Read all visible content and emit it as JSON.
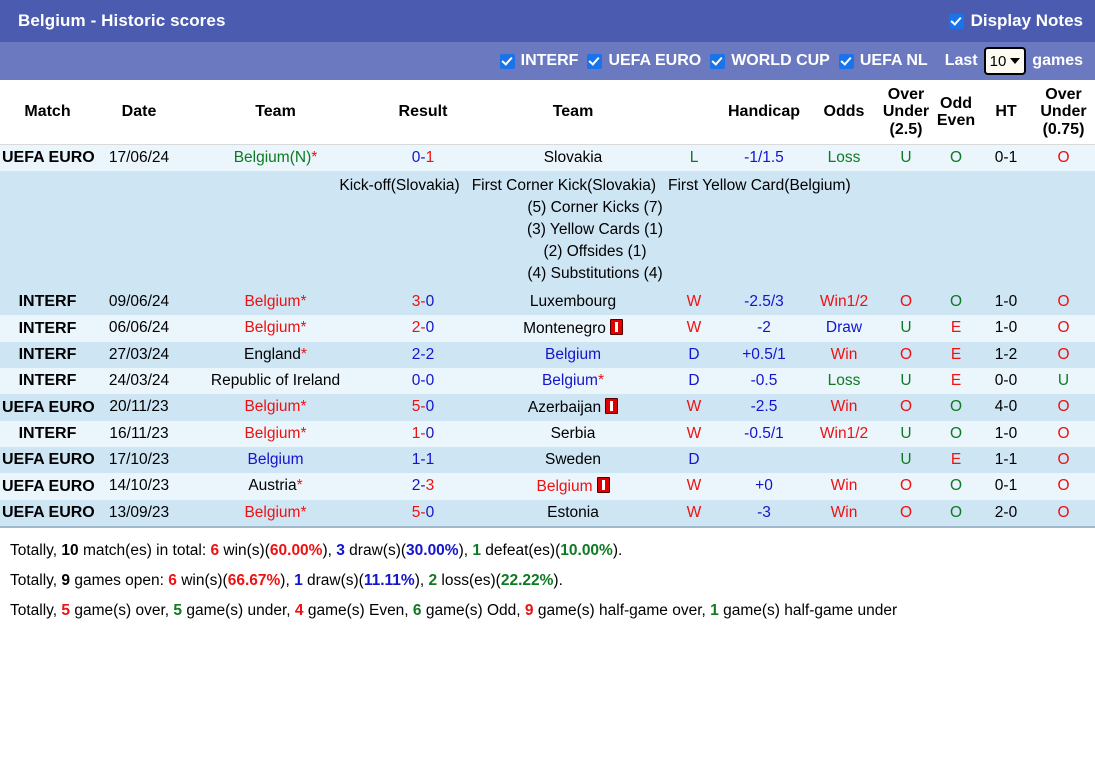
{
  "header": {
    "title": "Belgium - Historic scores",
    "display_notes_label": "Display Notes",
    "display_notes_checked": true,
    "accent_bar": "#4a5bb0",
    "filter_bar": "#6a79c0"
  },
  "filters": {
    "items": [
      {
        "label": "INTERF",
        "checked": true
      },
      {
        "label": "UEFA EURO",
        "checked": true
      },
      {
        "label": "WORLD CUP",
        "checked": true
      },
      {
        "label": "UEFA NL",
        "checked": true
      }
    ],
    "last_label": "Last",
    "games_value": "10",
    "games_label": "games"
  },
  "columns": [
    {
      "key": "match",
      "label": "Match"
    },
    {
      "key": "date",
      "label": "Date"
    },
    {
      "key": "home",
      "label": "Team"
    },
    {
      "key": "result",
      "label": "Result"
    },
    {
      "key": "away",
      "label": "Team"
    },
    {
      "key": "wdl",
      "label": ""
    },
    {
      "key": "handicap",
      "label": "Handicap"
    },
    {
      "key": "odds",
      "label": "Odds"
    },
    {
      "key": "ou25",
      "label": "Over Under (2.5)"
    },
    {
      "key": "oddeven",
      "label": "Odd Even"
    },
    {
      "key": "ht",
      "label": "HT"
    },
    {
      "key": "ou075",
      "label": "Over Under (0.75)"
    }
  ],
  "column_labels": {
    "ou25_l1": "Over",
    "ou25_l2": "Under",
    "ou25_l3": "(2.5)",
    "oddeven_l1": "Odd",
    "oddeven_l2": "Even",
    "ou075_l1": "Over",
    "ou075_l2": "Under",
    "ou075_l3": "(0.75)"
  },
  "rows": [
    {
      "comp": "UEFA EURO",
      "comp_type": "euro",
      "date": "17/06/24",
      "home": "Belgium(N)",
      "home_color": "green",
      "home_star": true,
      "home_card": false,
      "result": "0-1",
      "result_left_color": "blue",
      "result_right_color": "red",
      "away": "Slovakia",
      "away_color": "black",
      "away_star": false,
      "away_card": false,
      "wdl": "L",
      "wdl_color": "green",
      "handicap": "-1/1.5",
      "handicap_color": "blue",
      "odds": "Loss",
      "odds_color": "green",
      "ou25": "U",
      "ou25_color": "green",
      "oddeven": "O",
      "oddeven_color": "green",
      "ht": "0-1",
      "ht_color": "black",
      "ou075": "O",
      "ou075_color": "red",
      "notes": {
        "line1": [
          "Kick-off(Slovakia)",
          "First Corner Kick(Slovakia)",
          "First Yellow Card(Belgium)"
        ],
        "lines": [
          "(5) Corner Kicks (7)",
          "(3) Yellow Cards (1)",
          "(2) Offsides (1)",
          "(4) Substitutions (4)"
        ]
      }
    },
    {
      "comp": "INTERF",
      "comp_type": "interf",
      "date": "09/06/24",
      "home": "Belgium",
      "home_color": "red",
      "home_star": true,
      "home_card": false,
      "result": "3-0",
      "result_left_color": "red",
      "result_right_color": "blue",
      "away": "Luxembourg",
      "away_color": "black",
      "away_star": false,
      "away_card": false,
      "wdl": "W",
      "wdl_color": "red",
      "handicap": "-2.5/3",
      "handicap_color": "blue",
      "odds": "Win1/2",
      "odds_color": "red",
      "ou25": "O",
      "ou25_color": "red",
      "oddeven": "O",
      "oddeven_color": "green",
      "ht": "1-0",
      "ht_color": "black",
      "ou075": "O",
      "ou075_color": "red",
      "notes": null
    },
    {
      "comp": "INTERF",
      "comp_type": "interf",
      "date": "06/06/24",
      "home": "Belgium",
      "home_color": "red",
      "home_star": true,
      "home_card": false,
      "result": "2-0",
      "result_left_color": "red",
      "result_right_color": "blue",
      "away": "Montenegro",
      "away_color": "black",
      "away_star": false,
      "away_card": true,
      "wdl": "W",
      "wdl_color": "red",
      "handicap": "-2",
      "handicap_color": "blue",
      "odds": "Draw",
      "odds_color": "blue",
      "ou25": "U",
      "ou25_color": "green",
      "oddeven": "E",
      "oddeven_color": "red",
      "ht": "1-0",
      "ht_color": "black",
      "ou075": "O",
      "ou075_color": "red",
      "notes": null
    },
    {
      "comp": "INTERF",
      "comp_type": "interf",
      "date": "27/03/24",
      "home": "England",
      "home_color": "black",
      "home_star": true,
      "home_card": false,
      "result": "2-2",
      "result_left_color": "blue",
      "result_right_color": "blue",
      "away": "Belgium",
      "away_color": "blue",
      "away_star": false,
      "away_card": false,
      "wdl": "D",
      "wdl_color": "blue",
      "handicap": "+0.5/1",
      "handicap_color": "blue",
      "odds": "Win",
      "odds_color": "red",
      "ou25": "O",
      "ou25_color": "red",
      "oddeven": "E",
      "oddeven_color": "red",
      "ht": "1-2",
      "ht_color": "black",
      "ou075": "O",
      "ou075_color": "red",
      "notes": null
    },
    {
      "comp": "INTERF",
      "comp_type": "interf",
      "date": "24/03/24",
      "home": "Republic of Ireland",
      "home_color": "black",
      "home_star": false,
      "home_card": false,
      "result": "0-0",
      "result_left_color": "blue",
      "result_right_color": "blue",
      "away": "Belgium",
      "away_color": "blue",
      "away_star": true,
      "away_card": false,
      "wdl": "D",
      "wdl_color": "blue",
      "handicap": "-0.5",
      "handicap_color": "blue",
      "odds": "Loss",
      "odds_color": "green",
      "ou25": "U",
      "ou25_color": "green",
      "oddeven": "E",
      "oddeven_color": "red",
      "ht": "0-0",
      "ht_color": "black",
      "ou075": "U",
      "ou075_color": "green",
      "notes": null
    },
    {
      "comp": "UEFA EURO",
      "comp_type": "euro",
      "date": "20/11/23",
      "home": "Belgium",
      "home_color": "red",
      "home_star": true,
      "home_card": false,
      "result": "5-0",
      "result_left_color": "red",
      "result_right_color": "blue",
      "away": "Azerbaijan",
      "away_color": "black",
      "away_star": false,
      "away_card": true,
      "wdl": "W",
      "wdl_color": "red",
      "handicap": "-2.5",
      "handicap_color": "blue",
      "odds": "Win",
      "odds_color": "red",
      "ou25": "O",
      "ou25_color": "red",
      "oddeven": "O",
      "oddeven_color": "green",
      "ht": "4-0",
      "ht_color": "black",
      "ou075": "O",
      "ou075_color": "red",
      "notes": null
    },
    {
      "comp": "INTERF",
      "comp_type": "interf",
      "date": "16/11/23",
      "home": "Belgium",
      "home_color": "red",
      "home_star": true,
      "home_card": false,
      "result": "1-0",
      "result_left_color": "red",
      "result_right_color": "blue",
      "away": "Serbia",
      "away_color": "black",
      "away_star": false,
      "away_card": false,
      "wdl": "W",
      "wdl_color": "red",
      "handicap": "-0.5/1",
      "handicap_color": "blue",
      "odds": "Win1/2",
      "odds_color": "red",
      "ou25": "U",
      "ou25_color": "green",
      "oddeven": "O",
      "oddeven_color": "green",
      "ht": "1-0",
      "ht_color": "black",
      "ou075": "O",
      "ou075_color": "red",
      "notes": null
    },
    {
      "comp": "UEFA EURO",
      "comp_type": "euro",
      "date": "17/10/23",
      "home": "Belgium",
      "home_color": "blue",
      "home_star": false,
      "home_card": false,
      "result": "1-1",
      "result_left_color": "blue",
      "result_right_color": "blue",
      "away": "Sweden",
      "away_color": "black",
      "away_star": false,
      "away_card": false,
      "wdl": "D",
      "wdl_color": "blue",
      "handicap": "",
      "handicap_color": "blue",
      "odds": "",
      "odds_color": "black",
      "ou25": "U",
      "ou25_color": "green",
      "oddeven": "E",
      "oddeven_color": "red",
      "ht": "1-1",
      "ht_color": "black",
      "ou075": "O",
      "ou075_color": "red",
      "notes": null
    },
    {
      "comp": "UEFA EURO",
      "comp_type": "euro",
      "date": "14/10/23",
      "home": "Austria",
      "home_color": "black",
      "home_star": true,
      "home_card": false,
      "result": "2-3",
      "result_left_color": "blue",
      "result_right_color": "red",
      "away": "Belgium",
      "away_color": "red",
      "away_star": false,
      "away_card": true,
      "wdl": "W",
      "wdl_color": "red",
      "handicap": "+0",
      "handicap_color": "blue",
      "odds": "Win",
      "odds_color": "red",
      "ou25": "O",
      "ou25_color": "red",
      "oddeven": "O",
      "oddeven_color": "green",
      "ht": "0-1",
      "ht_color": "black",
      "ou075": "O",
      "ou075_color": "red",
      "notes": null
    },
    {
      "comp": "UEFA EURO",
      "comp_type": "euro",
      "date": "13/09/23",
      "home": "Belgium",
      "home_color": "red",
      "home_star": true,
      "home_card": false,
      "result": "5-0",
      "result_left_color": "red",
      "result_right_color": "blue",
      "away": "Estonia",
      "away_color": "black",
      "away_star": false,
      "away_card": false,
      "wdl": "W",
      "wdl_color": "red",
      "handicap": "-3",
      "handicap_color": "blue",
      "odds": "Win",
      "odds_color": "red",
      "ou25": "O",
      "ou25_color": "red",
      "oddeven": "O",
      "oddeven_color": "green",
      "ht": "2-0",
      "ht_color": "black",
      "ou075": "O",
      "ou075_color": "red",
      "notes": null
    }
  ],
  "summary": {
    "line1": [
      {
        "t": "Totally, ",
        "c": "plain"
      },
      {
        "t": "10",
        "c": "black"
      },
      {
        "t": " match(es) in total: ",
        "c": "plain"
      },
      {
        "t": "6",
        "c": "red"
      },
      {
        "t": " win(s)(",
        "c": "plain"
      },
      {
        "t": "60.00%",
        "c": "red"
      },
      {
        "t": "), ",
        "c": "plain"
      },
      {
        "t": "3",
        "c": "blue"
      },
      {
        "t": " draw(s)(",
        "c": "plain"
      },
      {
        "t": "30.00%",
        "c": "blue"
      },
      {
        "t": "), ",
        "c": "plain"
      },
      {
        "t": "1",
        "c": "green"
      },
      {
        "t": " defeat(es)(",
        "c": "plain"
      },
      {
        "t": "10.00%",
        "c": "green"
      },
      {
        "t": ").",
        "c": "plain"
      }
    ],
    "line2": [
      {
        "t": "Totally, ",
        "c": "plain"
      },
      {
        "t": "9",
        "c": "black"
      },
      {
        "t": " games open: ",
        "c": "plain"
      },
      {
        "t": "6",
        "c": "red"
      },
      {
        "t": " win(s)(",
        "c": "plain"
      },
      {
        "t": "66.67%",
        "c": "red"
      },
      {
        "t": "), ",
        "c": "plain"
      },
      {
        "t": "1",
        "c": "blue"
      },
      {
        "t": " draw(s)(",
        "c": "plain"
      },
      {
        "t": "11.11%",
        "c": "blue"
      },
      {
        "t": "), ",
        "c": "plain"
      },
      {
        "t": "2",
        "c": "green"
      },
      {
        "t": " loss(es)(",
        "c": "plain"
      },
      {
        "t": "22.22%",
        "c": "green"
      },
      {
        "t": ").",
        "c": "plain"
      }
    ],
    "line3": [
      {
        "t": "Totally, ",
        "c": "plain"
      },
      {
        "t": "5",
        "c": "red"
      },
      {
        "t": " game(s) over, ",
        "c": "plain"
      },
      {
        "t": "5",
        "c": "green"
      },
      {
        "t": " game(s) under, ",
        "c": "plain"
      },
      {
        "t": "4",
        "c": "red"
      },
      {
        "t": " game(s) Even, ",
        "c": "plain"
      },
      {
        "t": "6",
        "c": "green"
      },
      {
        "t": " game(s) Odd, ",
        "c": "plain"
      },
      {
        "t": "9",
        "c": "red"
      },
      {
        "t": " game(s) half-game over, ",
        "c": "plain"
      },
      {
        "t": "1",
        "c": "green"
      },
      {
        "t": " game(s) half-game under",
        "c": "plain"
      }
    ]
  },
  "colors": {
    "win": "#ee1111",
    "draw": "#1414cc",
    "loss": "#0e7a22",
    "badge_euro": "#9c8960",
    "badge_interf": "#a0a030",
    "row_light": "#eaf5fc",
    "row_dark": "#cee5f4"
  }
}
